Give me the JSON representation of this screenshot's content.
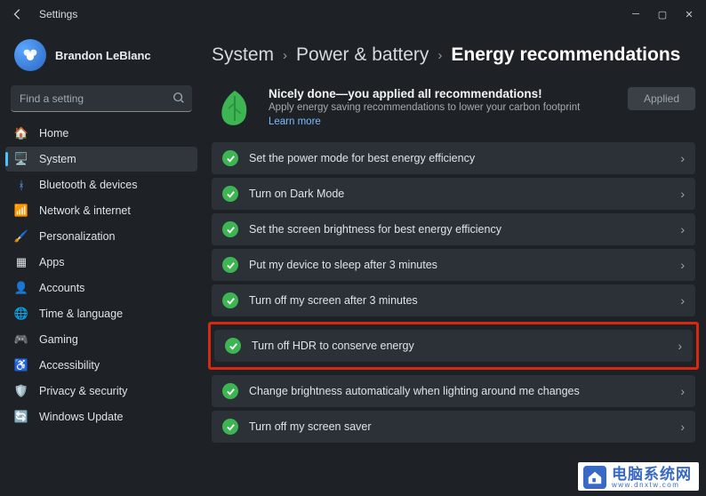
{
  "app_title": "Settings",
  "user": {
    "name": "Brandon LeBlanc"
  },
  "search": {
    "placeholder": "Find a setting"
  },
  "nav": [
    {
      "id": "home",
      "label": "Home"
    },
    {
      "id": "system",
      "label": "System",
      "active": true
    },
    {
      "id": "bluetooth",
      "label": "Bluetooth & devices"
    },
    {
      "id": "network",
      "label": "Network & internet"
    },
    {
      "id": "personalization",
      "label": "Personalization"
    },
    {
      "id": "apps",
      "label": "Apps"
    },
    {
      "id": "accounts",
      "label": "Accounts"
    },
    {
      "id": "time",
      "label": "Time & language"
    },
    {
      "id": "gaming",
      "label": "Gaming"
    },
    {
      "id": "accessibility",
      "label": "Accessibility"
    },
    {
      "id": "privacy",
      "label": "Privacy & security"
    },
    {
      "id": "update",
      "label": "Windows Update"
    }
  ],
  "breadcrumb": {
    "l1": "System",
    "l2": "Power & battery",
    "current": "Energy recommendations"
  },
  "hero": {
    "title": "Nicely done—you applied all recommendations!",
    "subtitle": "Apply energy saving recommendations to lower your carbon footprint",
    "link": "Learn more",
    "button": "Applied"
  },
  "recommendations": [
    {
      "label": "Set the power mode for best energy efficiency"
    },
    {
      "label": "Turn on Dark Mode"
    },
    {
      "label": "Set the screen brightness for best energy efficiency"
    },
    {
      "label": "Put my device to sleep after 3 minutes"
    },
    {
      "label": "Turn off my screen after 3 minutes"
    },
    {
      "label": "Turn off HDR to conserve energy",
      "highlighted": true
    },
    {
      "label": "Change brightness automatically when lighting around me changes"
    },
    {
      "label": "Turn off my screen saver"
    }
  ],
  "watermark": {
    "text": "电脑系统网",
    "url": "www.dnxtw.com"
  }
}
